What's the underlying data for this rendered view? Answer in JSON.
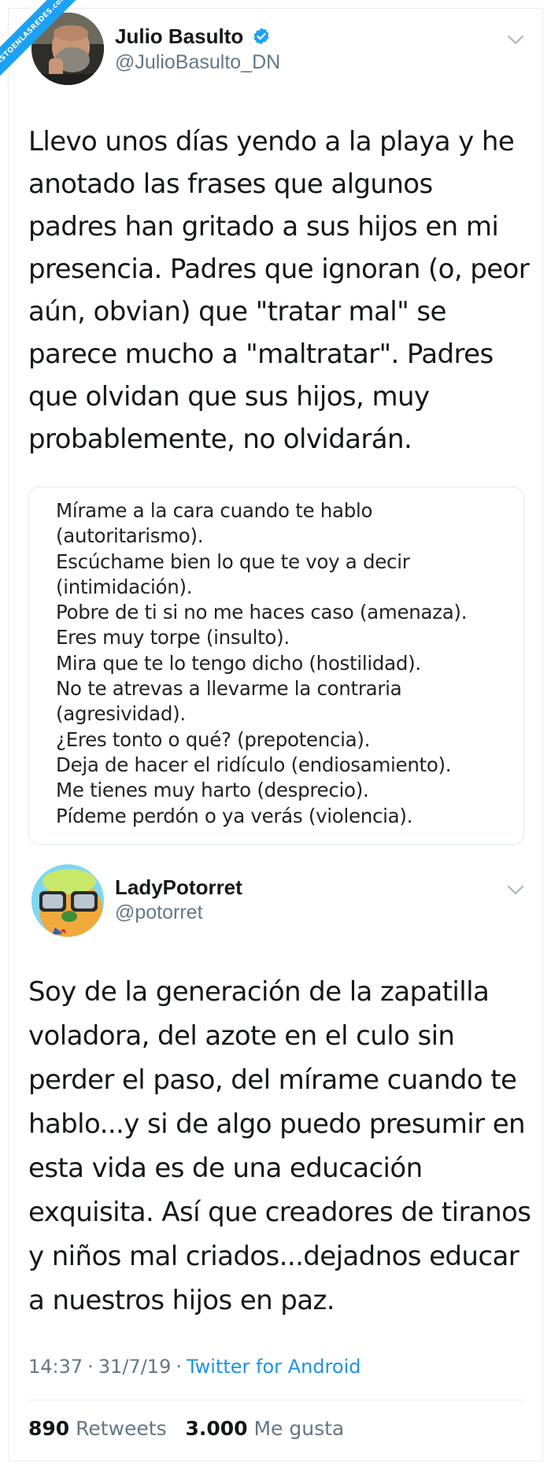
{
  "watermark": "VISTOENLASREDES.com",
  "tweet1": {
    "name": "Julio Basulto",
    "handle": "@JulioBasulto_DN",
    "verified": true,
    "text_lines": [
      "Llevo unos días yendo a la playa y he",
      "anotado las frases que algunos",
      "padres han gritado a sus hijos en mi",
      "presencia. Padres que ignoran (o, peor",
      "aún, obvian) que \"tratar mal\" se",
      "parece mucho a \"maltratar\". Padres",
      "que olvidan que sus hijos, muy",
      "probablemente, no olvidarán."
    ],
    "quote_lines": [
      "Mírame a la cara cuando te hablo",
      "(autoritarismo).",
      "Escúchame bien lo que te voy a decir",
      "(intimidación).",
      "Pobre de ti si no me haces caso (amenaza).",
      "Eres muy torpe (insulto).",
      "Mira que te lo tengo dicho (hostilidad).",
      "No te atrevas a llevarme la contraria",
      "(agresividad).",
      "¿Eres tonto o qué? (prepotencia).",
      "Deja de hacer el ridículo (endiosamiento).",
      "Me tienes muy harto (desprecio).",
      "Pídeme perdón o ya verás (violencia)."
    ]
  },
  "tweet2": {
    "name": "LadyPotorret",
    "handle": "@potorret",
    "text_lines": [
      "Soy de la generación de la zapatilla",
      "voladora, del azote en el culo sin",
      "perder el paso, del mírame cuando te",
      "hablo...y si de algo puedo presumir en",
      "esta vida es de una educación",
      "exquisita. Así que creadores de tiranos",
      "y niños mal criados...dejadnos educar",
      "a nuestros hijos en paz."
    ],
    "time": "14:37",
    "date": "31/7/19",
    "source": "Twitter for Android",
    "retweets_count": "890",
    "retweets_label": "Retweets",
    "likes_count": "3.000",
    "likes_label": "Me gusta"
  },
  "colors": {
    "accent": "#1da1f2",
    "link": "#1b95e0",
    "muted": "#657786",
    "border": "#e6ecf0"
  },
  "icons": [
    "verified-badge-icon",
    "chevron-down-icon"
  ]
}
